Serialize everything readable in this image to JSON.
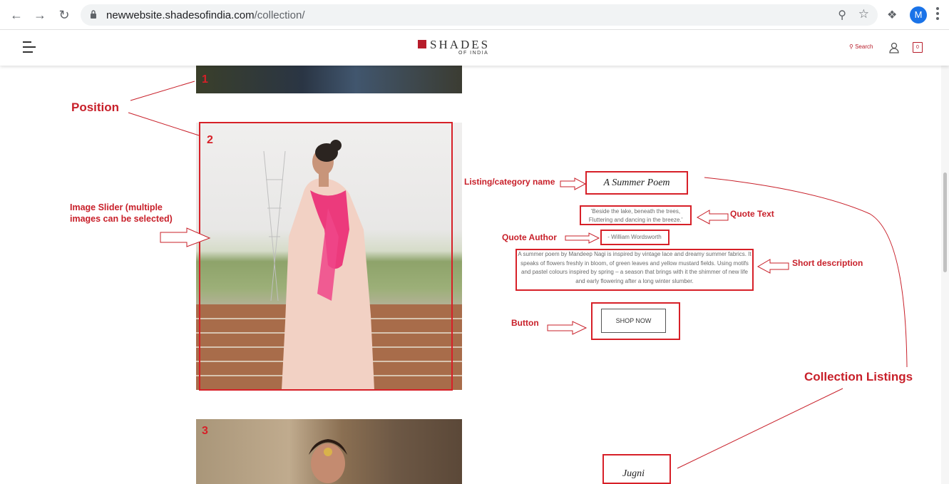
{
  "browser": {
    "url_host": "newwebsite.shadesofindia.com",
    "url_path": "/collection/",
    "avatar_letter": "M",
    "icons": [
      "back-icon",
      "forward-icon",
      "reload-icon",
      "lock-icon",
      "zoom-icon",
      "star-icon",
      "extensions-icon",
      "menu-icon"
    ]
  },
  "header": {
    "logo_main": "SHADES",
    "logo_sub": "OF INDIA",
    "search_label": "Search",
    "cart_count": "0",
    "brand_color": "#b71c2a"
  },
  "collection": {
    "positions": [
      "1",
      "2",
      "3"
    ],
    "listing_title": "A Summer Poem",
    "quote_text": "'Beside the lake, beneath the trees, Fluttering and dancing in the breeze.'",
    "quote_author": "- William Wordsworth",
    "short_description": "A summer poem by Mandeep Nagi is inspired by vintage lace and dreamy summer fabrics. It speaks of flowers freshly in bloom, of green leaves and yellow mustard fields. Using motifs and pastel colours inspired by spring – a season that brings with it the shimmer of new life and early flowering after a long winter slumber.",
    "button_label": "SHOP NOW",
    "next_listing_title": "Jugni"
  },
  "annotations": {
    "position": "Position",
    "image_slider": "Image Slider (multiple images can be selected)",
    "listing_name": "Listing/category name",
    "quote_text": "Quote Text",
    "quote_author": "Quote Author",
    "short_description": "Short description",
    "button": "Button",
    "collection_listings": "Collection Listings",
    "annotation_color": "#d72028"
  }
}
